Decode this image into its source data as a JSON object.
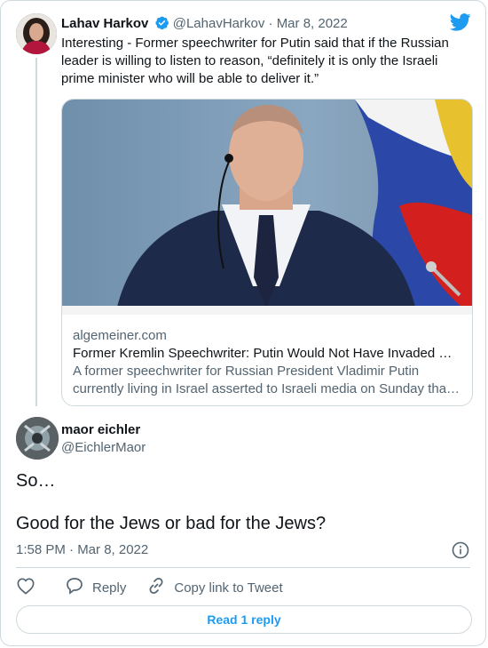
{
  "tweet": {
    "author_name": "Lahav Harkov",
    "author_handle": "@LahavHarkov",
    "separator": "·",
    "date": "Mar 8, 2022",
    "text": "Interesting - Former speechwriter for Putin said that if the Russian leader is willing to listen to reason, “definitely it is only the Israeli prime minister who will be able to deliver it.”",
    "link_card": {
      "domain": "algemeiner.com",
      "title": "Former Kremlin Speechwriter: Putin Would Not Have Invaded …",
      "description": "A former speechwriter for Russian President Vladimir Putin currently living in Israel asserted to Israeli media on Sunday tha…"
    }
  },
  "reply": {
    "author_name": "maor eichler",
    "author_handle": "@EichlerMaor",
    "text_line1": "So…",
    "text_line2": "Good for the Jews or bad for the Jews?",
    "timestamp": "1:58 PM · Mar 8, 2022",
    "actions": {
      "reply_label": "Reply",
      "copy_link_label": "Copy link to Tweet"
    },
    "read_replies_label": "Read 1 reply"
  },
  "icons": {
    "verified": "verified-badge-icon",
    "brand": "twitter-bird-icon",
    "info": "info-icon",
    "like": "heart-icon",
    "reply": "speech-bubble-icon",
    "copy_link": "link-icon"
  },
  "colors": {
    "brand_blue": "#1d9bf0",
    "text_primary": "#0f1419",
    "text_secondary": "#536471",
    "border": "#cfd9de"
  }
}
